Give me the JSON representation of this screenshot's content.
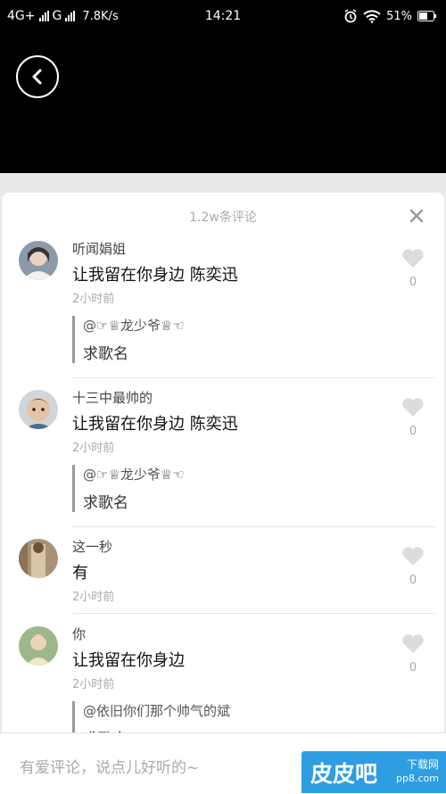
{
  "status_bar": {
    "network1": "4G+",
    "network2": "G",
    "speed": "7.8K/s",
    "time": "14:21",
    "battery": "51%",
    "icons": [
      "signal-icon",
      "alarm-icon",
      "wifi-icon",
      "battery-icon"
    ]
  },
  "header": {
    "back_icon": "chevron-left-icon"
  },
  "sheet": {
    "title": "1.2w条评论",
    "close_icon": "close-icon"
  },
  "comments": [
    {
      "username": "听闻娟姐",
      "content": "让我留在你身边 陈奕迅",
      "time": "2小时前",
      "likes": "0",
      "reply_user": "@☞♕龙少爷♕☜",
      "reply_text": "求歌名"
    },
    {
      "username": "十三中最帅的",
      "content": "让我留在你身边  陈奕迅",
      "time": "2小时前",
      "likes": "0",
      "reply_user": "@☞♕龙少爷♕☜",
      "reply_text": "求歌名"
    },
    {
      "username": "这一秒",
      "content": "有",
      "time": "2小时前",
      "likes": "0"
    },
    {
      "username": "你",
      "content": "让我留在你身边",
      "time": "2小时前",
      "likes": "0",
      "reply_user": "@依旧你们那个帅气的斌",
      "reply_text": "求歌名"
    }
  ],
  "input": {
    "placeholder": "有爱评论，说点儿好听的~"
  },
  "watermark": {
    "main": "皮皮吧",
    "sub1": "下载网",
    "sub2": "pp8.com"
  },
  "colors": {
    "accent": "#2e9de2",
    "heart": "#dcdcdc"
  }
}
